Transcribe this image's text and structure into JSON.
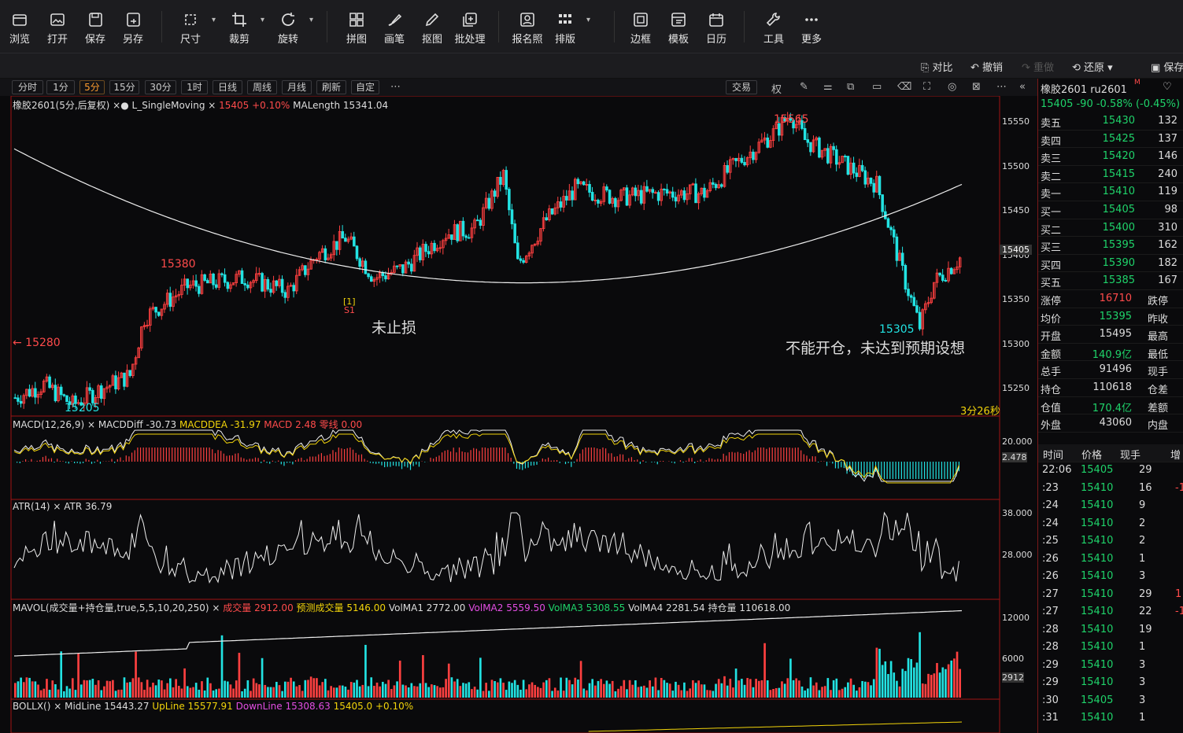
{
  "toolbar": {
    "items": [
      {
        "label": "浏览",
        "icon": "folder-icon"
      },
      {
        "label": "打开",
        "icon": "image-open-icon"
      },
      {
        "label": "保存",
        "icon": "save-icon"
      },
      {
        "label": "另存",
        "icon": "save-as-icon"
      },
      {
        "label": "尺寸",
        "icon": "resize-icon"
      },
      {
        "label": "裁剪",
        "icon": "crop-icon"
      },
      {
        "label": "旋转",
        "icon": "rotate-icon"
      },
      {
        "label": "拼图",
        "icon": "collage-icon"
      },
      {
        "label": "画笔",
        "icon": "brush-icon"
      },
      {
        "label": "抠图",
        "icon": "cutout-icon"
      },
      {
        "label": "批处理",
        "icon": "batch-icon"
      },
      {
        "label": "报名照",
        "icon": "id-photo-icon"
      },
      {
        "label": "排版",
        "icon": "layout-icon"
      },
      {
        "label": "边框",
        "icon": "border-icon"
      },
      {
        "label": "模板",
        "icon": "template-icon"
      },
      {
        "label": "日历",
        "icon": "calendar-icon"
      },
      {
        "label": "工具",
        "icon": "wrench-icon"
      },
      {
        "label": "更多",
        "icon": "more-icon"
      }
    ]
  },
  "subbar": {
    "compare": "对比",
    "undo": "撤销",
    "redo": "重做",
    "restore": "还原",
    "save": "保存"
  },
  "periods": [
    "分时",
    "1分",
    "5分",
    "15分",
    "30分",
    "1时",
    "日线",
    "周线",
    "月线",
    "刷新",
    "自定"
  ],
  "active_period": "5分",
  "trade_button": "交易",
  "rights_label": "权",
  "main": {
    "legend_name": "橡胶2601(5分,后复权)",
    "legend_indicator": "L_SingleMoving",
    "legend_last": "15405 +0.10%",
    "legend_ma": "MALength 15341.04",
    "price_ticks": [
      "15550",
      "15500",
      "15450",
      "15400",
      "15350",
      "15300",
      "15250"
    ],
    "current_tag": "15405",
    "hi_label": "15565",
    "lo_label_1": "15205",
    "lo_label_2": "15305",
    "mark_label": "15380",
    "signal_label": "[1]",
    "signal_sub": "S1",
    "note_1": "未止损",
    "note_2": "不能开仓，未达到预期设想",
    "countdown": "3分26秒"
  },
  "macd": {
    "name": "MACD(12,26,9)",
    "diff": "MACDDiff -30.73",
    "dea": "MACDDEA -31.97",
    "macd": "MACD 2.48",
    "zero": "零线 0.00",
    "ticks": [
      "20.000",
      "2.478"
    ]
  },
  "atr": {
    "name": "ATR(14)",
    "value": "ATR 36.79",
    "ticks": [
      "38.000",
      "28.000"
    ]
  },
  "vol": {
    "name": "MAVOL(成交量+持仓量,true,5,5,10,20,250)",
    "v": "成交量 2912.00",
    "pred": "预测成交量 5146.00",
    "ma1": "VolMA1 2772.00",
    "ma2": "VolMA2 5559.50",
    "ma3": "VolMA3 5308.55",
    "ma4": "VolMA4 2281.54",
    "oi": "持仓量 110618.00",
    "ticks": [
      "12000",
      "6000",
      "2912"
    ]
  },
  "boll": {
    "name": "BOLLX()",
    "mid": "MidLine 15443.27",
    "up": "UpLine 15577.91",
    "down": "DownLine 15308.63",
    "last": "15405.0 +0.10%"
  },
  "side": {
    "title": "橡胶2601 ru2601",
    "title_sup": "M",
    "quote": "15405  -90  -0.58%  (-0.45%)",
    "book": [
      {
        "k": "卖五",
        "p": "15430",
        "v": "132"
      },
      {
        "k": "卖四",
        "p": "15425",
        "v": "137"
      },
      {
        "k": "卖三",
        "p": "15420",
        "v": "146"
      },
      {
        "k": "卖二",
        "p": "15415",
        "v": "240"
      },
      {
        "k": "卖一",
        "p": "15410",
        "v": "119"
      },
      {
        "k": "买一",
        "p": "15405",
        "v": "98"
      },
      {
        "k": "买二",
        "p": "15400",
        "v": "310"
      },
      {
        "k": "买三",
        "p": "15395",
        "v": "162"
      },
      {
        "k": "买四",
        "p": "15390",
        "v": "182"
      },
      {
        "k": "买五",
        "p": "15385",
        "v": "167"
      }
    ],
    "stats": [
      {
        "k": "涨停",
        "v": "16710",
        "k2": "跌停"
      },
      {
        "k": "均价",
        "v": "15395",
        "k2": "昨收"
      },
      {
        "k": "开盘",
        "v": "15495",
        "k2": "最高"
      },
      {
        "k": "金额",
        "v": "140.9亿",
        "k2": "最低"
      },
      {
        "k": "总手",
        "v": "91496",
        "k2": "现手"
      },
      {
        "k": "持仓",
        "v": "110618",
        "k2": "仓差"
      },
      {
        "k": "仓值",
        "v": "170.4亿",
        "k2": "差额"
      },
      {
        "k": "外盘",
        "v": "43060",
        "k2": "内盘"
      }
    ],
    "tick_headers": [
      "时间",
      "价格",
      "现手",
      "增"
    ],
    "ticks": [
      {
        "t": "22:06",
        "p": "15405",
        "v": "29",
        "x": ""
      },
      {
        "t": ":23",
        "p": "15410",
        "v": "16",
        "x": "-1"
      },
      {
        "t": ":24",
        "p": "15410",
        "v": "9",
        "x": ""
      },
      {
        "t": ":24",
        "p": "15410",
        "v": "2",
        "x": ""
      },
      {
        "t": ":25",
        "p": "15410",
        "v": "2",
        "x": ""
      },
      {
        "t": ":26",
        "p": "15410",
        "v": "1",
        "x": ""
      },
      {
        "t": ":26",
        "p": "15410",
        "v": "3",
        "x": ""
      },
      {
        "t": ":27",
        "p": "15410",
        "v": "29",
        "x": "1"
      },
      {
        "t": ":27",
        "p": "15410",
        "v": "22",
        "x": "-1"
      },
      {
        "t": ":28",
        "p": "15410",
        "v": "19",
        "x": ""
      },
      {
        "t": ":28",
        "p": "15410",
        "v": "1",
        "x": ""
      },
      {
        "t": ":29",
        "p": "15410",
        "v": "3",
        "x": ""
      },
      {
        "t": ":29",
        "p": "15410",
        "v": "3",
        "x": ""
      },
      {
        "t": ":30",
        "p": "15405",
        "v": "3",
        "x": ""
      },
      {
        "t": ":31",
        "p": "15410",
        "v": "1",
        "x": ""
      }
    ]
  },
  "chart_data": {
    "type": "candlestick",
    "symbol": "橡胶2601",
    "period": "5分",
    "y_range": [
      15230,
      15590
    ],
    "close_anchors": [
      [
        0,
        15240
      ],
      [
        10,
        15255
      ],
      [
        20,
        15232
      ],
      [
        30,
        15250
      ],
      [
        40,
        15265
      ],
      [
        45,
        15330
      ],
      [
        60,
        15365
      ],
      [
        80,
        15375
      ],
      [
        95,
        15360
      ],
      [
        105,
        15400
      ],
      [
        115,
        15420
      ],
      [
        125,
        15375
      ],
      [
        135,
        15385
      ],
      [
        150,
        15425
      ],
      [
        160,
        15430
      ],
      [
        170,
        15490
      ],
      [
        175,
        15390
      ],
      [
        185,
        15440
      ],
      [
        195,
        15475
      ],
      [
        210,
        15465
      ],
      [
        225,
        15470
      ],
      [
        240,
        15470
      ],
      [
        250,
        15500
      ],
      [
        265,
        15540
      ],
      [
        270,
        15560
      ],
      [
        275,
        15530
      ],
      [
        285,
        15510
      ],
      [
        300,
        15480
      ],
      [
        310,
        15370
      ],
      [
        315,
        15320
      ],
      [
        320,
        15370
      ],
      [
        330,
        15400
      ]
    ]
  }
}
